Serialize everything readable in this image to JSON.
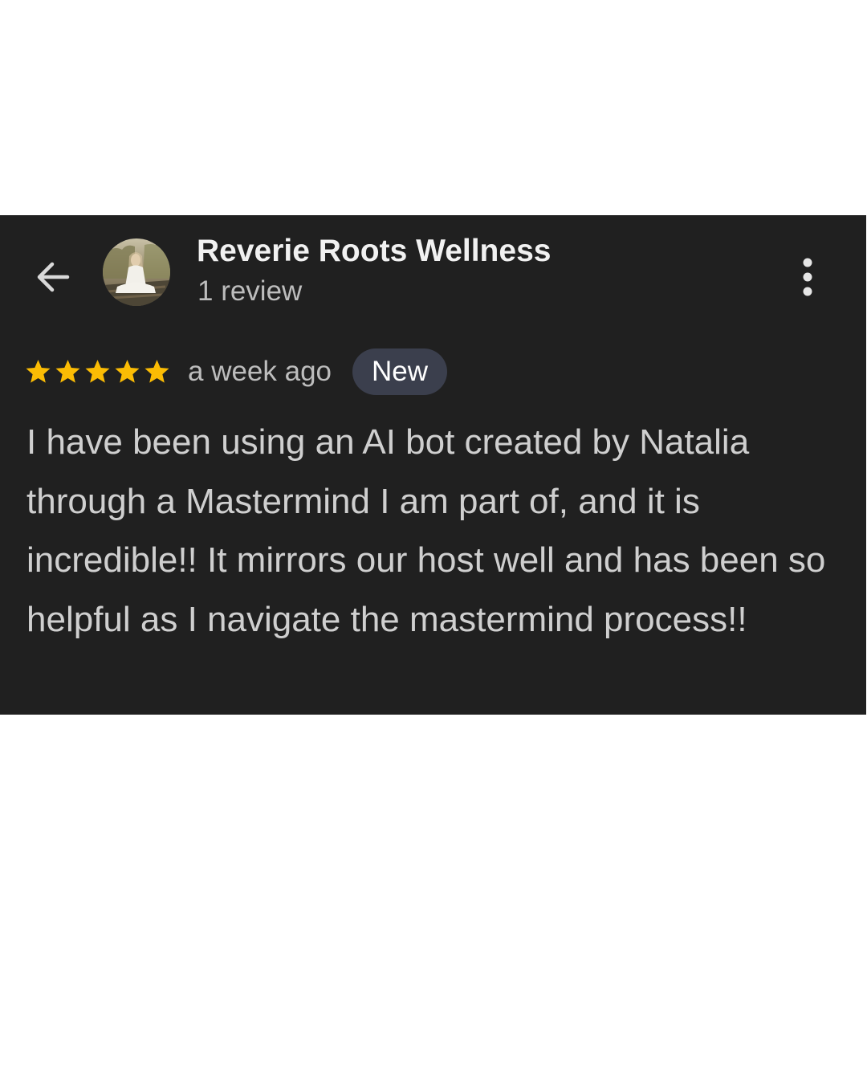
{
  "header": {
    "back_icon": "arrow-left-icon",
    "reviewer_name": "Reverie Roots Wellness",
    "review_count": "1 review",
    "menu_icon": "more-vert-icon"
  },
  "review": {
    "rating": 5,
    "rating_max": 5,
    "star_color": "#fbbc04",
    "time": "a week ago",
    "badge": "New",
    "text": "I have been using an AI bot created by Natalia through a Mastermind I am part of, and it is incredible!! It mirrors our host well and has been so helpful as I navigate the mastermind process!!"
  },
  "colors": {
    "card_background": "#202020",
    "badge_background": "#3b3f4d"
  }
}
